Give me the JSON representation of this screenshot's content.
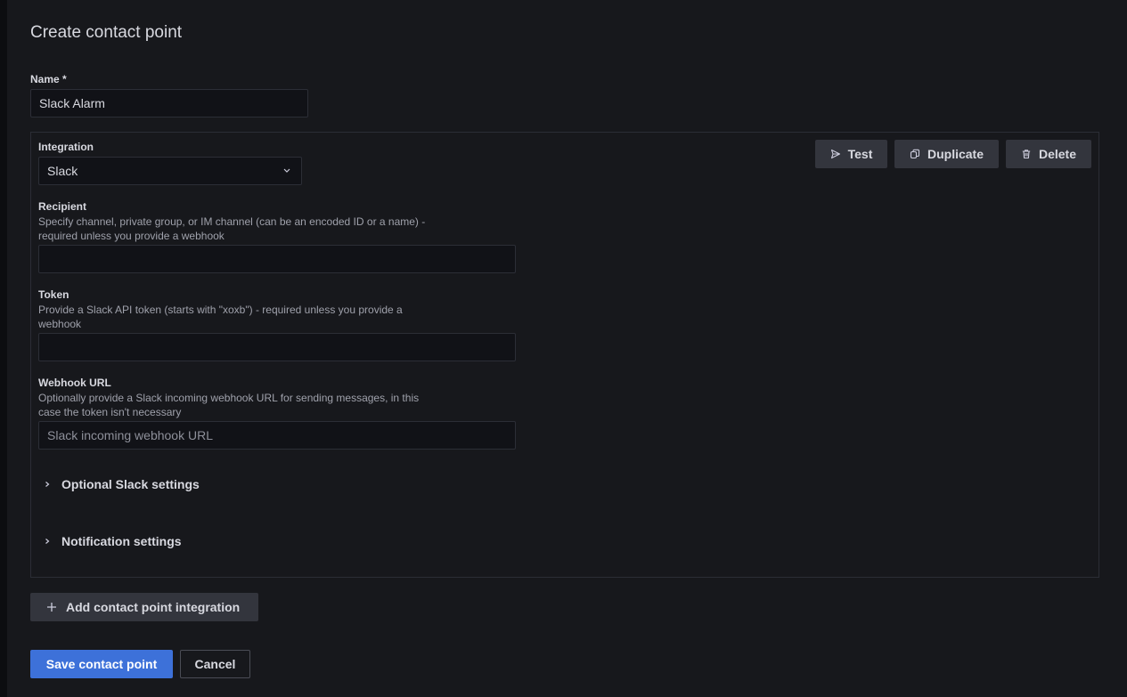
{
  "page": {
    "title": "Create contact point"
  },
  "name_field": {
    "label": "Name *",
    "value": "Slack Alarm"
  },
  "integration": {
    "label": "Integration",
    "selected": "Slack",
    "caret_icon": "chevron-down-icon",
    "actions": {
      "test": "Test",
      "duplicate": "Duplicate",
      "delete": "Delete"
    }
  },
  "recipient": {
    "label": "Recipient",
    "desc_line1": "Specify channel, private group, or IM channel (can be an encoded ID or a name) -",
    "desc_line2": "required unless you provide a webhook",
    "value": ""
  },
  "token": {
    "label": "Token",
    "desc_line1": "Provide a Slack API token (starts with \"xoxb\") - required unless you provide a",
    "desc_line2": "webhook",
    "value": ""
  },
  "webhook": {
    "label": "Webhook URL",
    "desc_line1": "Optionally provide a Slack incoming webhook URL for sending messages, in this",
    "desc_line2": "case the token isn't necessary",
    "placeholder": "Slack incoming webhook URL"
  },
  "sections": {
    "optional_slack": "Optional Slack settings",
    "notification": "Notification settings"
  },
  "add_integration": {
    "label": "Add contact point integration"
  },
  "footer": {
    "save": "Save contact point",
    "cancel": "Cancel"
  },
  "colors": {
    "background": "#17181c",
    "primary": "#3d71d9",
    "button": "#33353d"
  }
}
